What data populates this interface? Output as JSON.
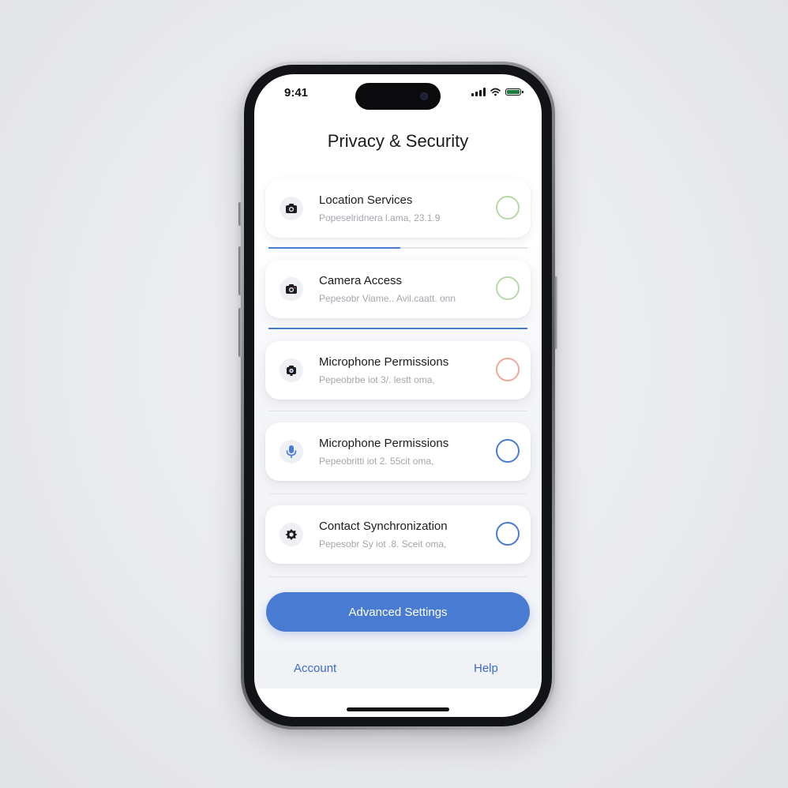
{
  "status_bar": {
    "time": "9:41"
  },
  "header": {
    "title": "Privacy & Security"
  },
  "settings": {
    "items": [
      {
        "title": "Location Services",
        "subtitle": "Popeselridnera l.ama, 23.1.9",
        "icon": "camera-icon",
        "toggle_color": "#b8d8a8"
      },
      {
        "title": "Camera Access",
        "subtitle": "Pepesobr Viame.. Avil.caatt. onn",
        "icon": "camera-icon",
        "toggle_color": "#b8d8a8"
      },
      {
        "title": "Microphone Permissions",
        "subtitle": "Pepeobrbe iot  3/. lestt oma,",
        "icon": "camera-gear-icon",
        "toggle_color": "#efa898"
      },
      {
        "title": "Microphone Permissions",
        "subtitle": "Pepeobritti iot  2. 55cit oma,",
        "icon": "microphone-icon",
        "toggle_color": "#4a7bd3"
      },
      {
        "title": "Contact Synchronization",
        "subtitle": "Pepesobr Sy iot  .8. Sceit oma,",
        "icon": "gear-icon",
        "toggle_color": "#4a7bd3"
      }
    ]
  },
  "progress": {
    "first_section_fraction": 0.51,
    "second_section_fraction": 1.0
  },
  "actions": {
    "advanced_label": "Advanced Settings"
  },
  "bottom_bar": {
    "left_label": "Account",
    "right_label": "Help"
  },
  "colors": {
    "accent": "#4a7bd3",
    "link": "#3c6cc4"
  }
}
